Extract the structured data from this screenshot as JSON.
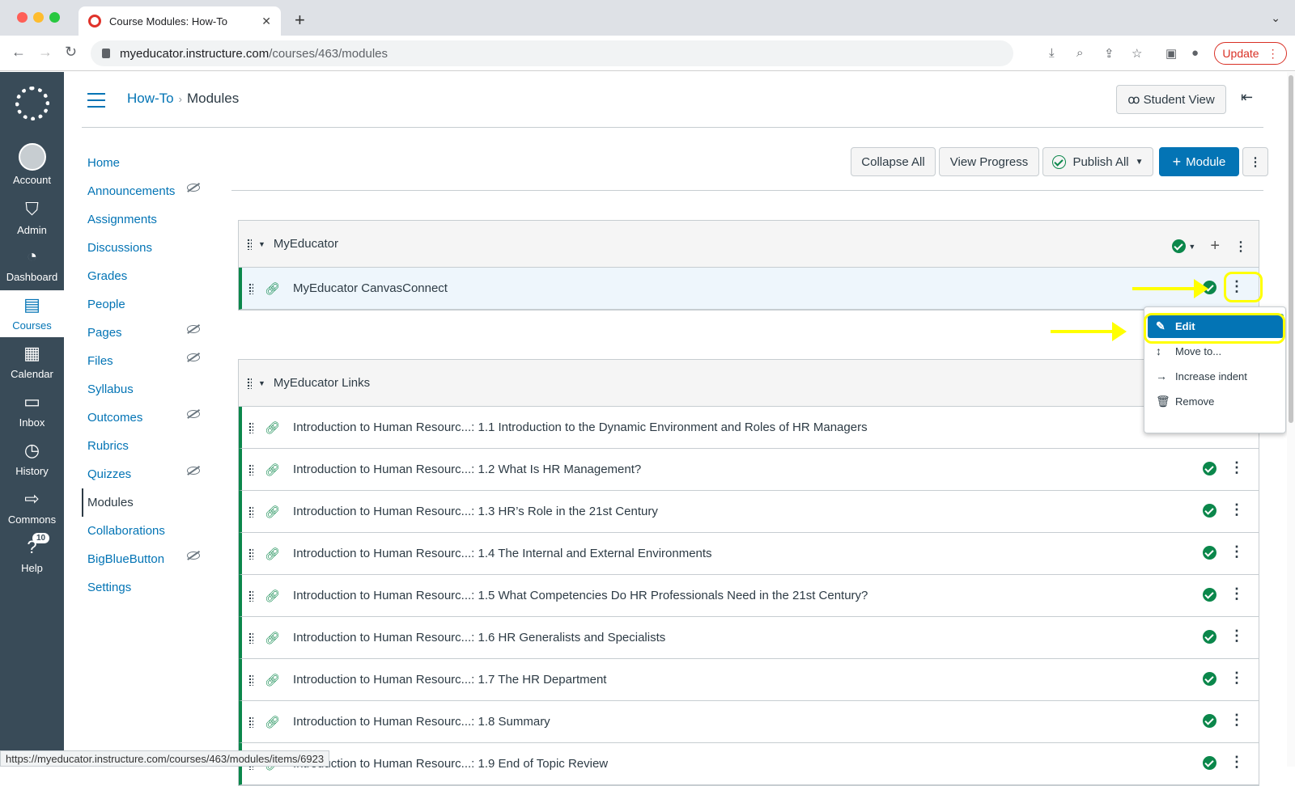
{
  "browser": {
    "tab_title": "Course Modules: How-To",
    "url_host": "myeducator.instructure.com",
    "url_path": "/courses/463/modules",
    "update_label": "Update",
    "status_url": "https://myeducator.instructure.com/courses/463/modules/items/6923"
  },
  "global_nav": {
    "items": [
      {
        "label": "Account",
        "icon": "avatar"
      },
      {
        "label": "Admin",
        "icon": "shield-icon"
      },
      {
        "label": "Dashboard",
        "icon": "dashboard-icon"
      },
      {
        "label": "Courses",
        "icon": "book-icon"
      },
      {
        "label": "Calendar",
        "icon": "calendar-icon"
      },
      {
        "label": "Inbox",
        "icon": "inbox-icon"
      },
      {
        "label": "History",
        "icon": "clock-icon"
      },
      {
        "label": "Commons",
        "icon": "commons-icon"
      },
      {
        "label": "Help",
        "icon": "help-icon",
        "badge": "10"
      }
    ]
  },
  "header": {
    "course": "How-To",
    "page": "Modules",
    "student_view": "Student View"
  },
  "course_nav": [
    {
      "label": "Home",
      "hidden": false
    },
    {
      "label": "Announcements",
      "hidden": true
    },
    {
      "label": "Assignments",
      "hidden": false
    },
    {
      "label": "Discussions",
      "hidden": false
    },
    {
      "label": "Grades",
      "hidden": false
    },
    {
      "label": "People",
      "hidden": false
    },
    {
      "label": "Pages",
      "hidden": true
    },
    {
      "label": "Files",
      "hidden": true
    },
    {
      "label": "Syllabus",
      "hidden": false
    },
    {
      "label": "Outcomes",
      "hidden": true
    },
    {
      "label": "Rubrics",
      "hidden": false
    },
    {
      "label": "Quizzes",
      "hidden": true
    },
    {
      "label": "Modules",
      "hidden": false,
      "active": true
    },
    {
      "label": "Collaborations",
      "hidden": false
    },
    {
      "label": "BigBlueButton",
      "hidden": true
    },
    {
      "label": "Settings",
      "hidden": false
    }
  ],
  "toolbar": {
    "collapse_all": "Collapse All",
    "view_progress": "View Progress",
    "publish_all": "Publish All",
    "add_module": "Module"
  },
  "modules": [
    {
      "title": "MyEducator",
      "items": [
        "MyEducator CanvasConnect"
      ]
    },
    {
      "title": "MyEducator Links",
      "items": [
        "Introduction to Human Resourc...: 1.1 Introduction to the Dynamic Environment and Roles of HR Managers",
        "Introduction to Human Resourc...: 1.2 What Is HR Management?",
        "Introduction to Human Resourc...: 1.3 HR’s Role in the 21st Century",
        "Introduction to Human Resourc...: 1.4 The Internal and External Environments",
        "Introduction to Human Resourc...: 1.5 What Competencies Do HR Professionals Need in the 21st Century?",
        "Introduction to Human Resourc...: 1.6 HR Generalists and Specialists",
        "Introduction to Human Resourc...: 1.7 The HR Department",
        "Introduction to Human Resourc...: 1.8 Summary",
        "Introduction to Human Resourc...: 1.9 End of Topic Review"
      ]
    }
  ],
  "menu": [
    {
      "label": "Edit",
      "icon": "pencil-icon"
    },
    {
      "label": "Move to...",
      "icon": "move-icon"
    },
    {
      "label": "Increase indent",
      "icon": "indent-arrow-icon"
    },
    {
      "label": "Remove",
      "icon": "trash-icon"
    }
  ],
  "colors": {
    "accent": "#0374b5",
    "published": "#0b874b",
    "nav_bg": "#394b58",
    "annotation": "#ffff00"
  }
}
